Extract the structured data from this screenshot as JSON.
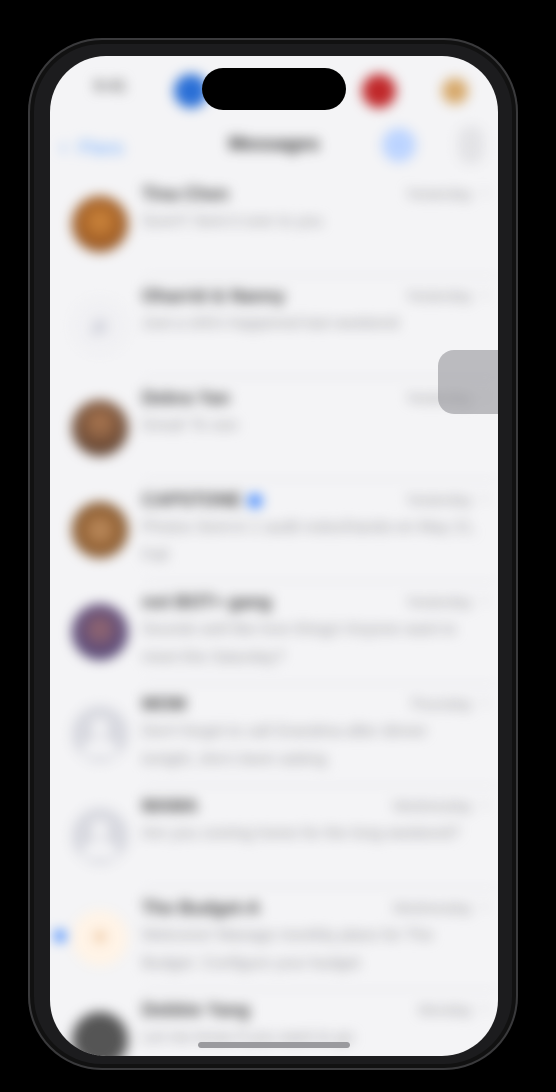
{
  "status_bar": {
    "time": "9:41",
    "indicator_colors": [
      "#2a6fd6",
      "#c0282a",
      "#d6a86a"
    ]
  },
  "nav": {
    "back_label": "Plans",
    "title": "Messages",
    "icons": [
      "chevron-left-icon",
      "compose-icon",
      "more-icon"
    ]
  },
  "conversations": [
    {
      "name": "Tina Chen",
      "time": "Yesterday",
      "preview": "Sure!!! Sent it over to you",
      "avatar": "photo",
      "unread": false
    },
    {
      "name": "Oharrid & Nanny",
      "time": "Yesterday",
      "preview": "Just a shit's happened last weekend",
      "avatar": "search",
      "unread": false
    },
    {
      "name": "Debra Yan",
      "time": "Yesterday",
      "preview": "Great! To see",
      "avatar": "photo",
      "unread": false
    },
    {
      "name": "CAPSTONE",
      "time": "Yesterday",
      "preview": "Photos Sent-in 1 audit notes/hands-on May 21, Fall",
      "avatar": "photo",
      "unread": false,
      "verified": true
    },
    {
      "name": "not BOT+ gang",
      "time": "Yesterday",
      "preview": "Sounds well like love things! Anyone want to meet this Saturday?",
      "avatar": "photo",
      "unread": false
    },
    {
      "name": "MOM",
      "time": "Thursday",
      "preview": "Don't forget to call Grandma after dinner tonight, she's been asking",
      "avatar": "person",
      "unread": false
    },
    {
      "name": "MAMA",
      "time": "Wednesday",
      "preview": "Are you coming home for the long weekend?",
      "avatar": "person",
      "unread": false
    },
    {
      "name": "The Budget-A",
      "time": "Wednesday",
      "preview": "Welcome! Manage monthly plans for The Budget. Configure your budget",
      "avatar": "logo",
      "unread": true
    },
    {
      "name": "Debbie Yang",
      "time": "Monday",
      "preview": "Let me know if you want to go",
      "avatar": "photo",
      "unread": false
    }
  ]
}
